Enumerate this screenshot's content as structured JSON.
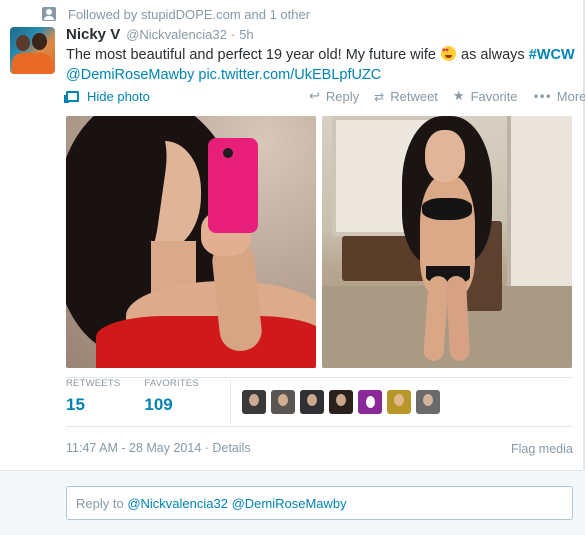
{
  "context": {
    "icon": "follow-person-icon",
    "text": "Followed by stupidDOPE.com and 1 other"
  },
  "tweet": {
    "fullname": "Nicky V",
    "screenname": "@Nickvalencia32",
    "separator": "·",
    "time": "5h",
    "text_before": "The most beautiful and perfect 19 year old! My future wife ",
    "emoji": "heart-eyes-emoji",
    "text_after": " as always ",
    "hashtag": "#WCW",
    "mention": "@DemiRoseMawby",
    "link": "pic.twitter.com/UkEBLpfUZC"
  },
  "media_toggle": {
    "label": "Hide photo"
  },
  "actions": {
    "reply": "Reply",
    "retweet": "Retweet",
    "favorite": "Favorite",
    "more": "More",
    "reply_icon": "↩",
    "retweet_icon": "⇄",
    "favorite_icon": "★",
    "more_icon": "•••"
  },
  "stats": {
    "retweets_label": "RETWEETS",
    "retweets_value": "15",
    "favorites_label": "FAVORITES",
    "favorites_value": "109"
  },
  "favoriters": [
    {
      "color": "#3a3a3a"
    },
    {
      "color": "#5a5550"
    },
    {
      "color": "#2f2f34"
    },
    {
      "color": "#2b211c"
    },
    {
      "color": "#8a2a9a",
      "egg": true
    },
    {
      "color": "#b8962a"
    },
    {
      "color": "#6b6b6b"
    }
  ],
  "footer": {
    "timestamp": "11:47 AM - 28 May 2014",
    "separator": " · ",
    "details": "Details",
    "flag_media": "Flag media"
  },
  "reply_box": {
    "prefix": "Reply to ",
    "mention1": "@Nickvalencia32",
    "mention2": "@DemiRoseMawby"
  },
  "colors": {
    "link": "#0084b4",
    "muted": "#8899a6",
    "text": "#292f33"
  }
}
